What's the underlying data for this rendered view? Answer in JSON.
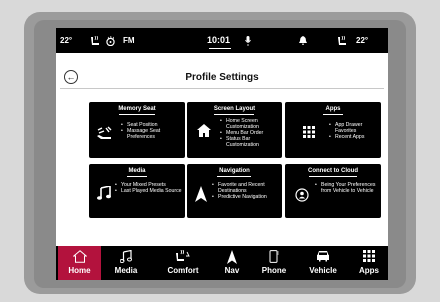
{
  "status_bar": {
    "temp_left": "22°",
    "seat_icon": "heated-seat-icon",
    "steering_icon": "heated-steering-icon",
    "radio_band": "FM",
    "clock": "10:01",
    "mic_icon": "microphone-icon",
    "notification_icon": "bell-icon",
    "temp_right": "22°"
  },
  "header": {
    "back_glyph": "←",
    "title": "Profile Settings"
  },
  "tiles": [
    {
      "title": "Memory Seat",
      "icon": "seat-memory-icon",
      "glyph": "⚙",
      "items": [
        "Seat Position",
        "Massage Seat Preferences"
      ]
    },
    {
      "title": "Screen Layout",
      "icon": "home-icon",
      "glyph": "⌂",
      "items": [
        "Home Screen Customization",
        "Menu Bar Order",
        "Status Bar Customization"
      ]
    },
    {
      "title": "Apps",
      "icon": "apps-grid-icon",
      "glyph": "▦",
      "items": [
        "App Drawer Favorites",
        "Recent Apps"
      ]
    },
    {
      "title": "Media",
      "icon": "music-note-icon",
      "glyph": "♫",
      "items": [
        "Your Mixed Presets",
        "Last Played Media Source"
      ]
    },
    {
      "title": "Navigation",
      "icon": "navigation-arrow-icon",
      "glyph": "▲",
      "items": [
        "Favorite and Recent Destinations",
        "Predictive Navigation"
      ]
    },
    {
      "title": "Connect to Cloud",
      "icon": "cloud-profile-icon",
      "glyph": "◉",
      "items": [
        "Being Your Preferences from Vehicle to Vehicle"
      ]
    }
  ],
  "nav": [
    {
      "label": "Home",
      "icon": "home-icon",
      "glyph": "⌂",
      "active": true
    },
    {
      "label": "Media",
      "icon": "music-note-icon",
      "glyph": "♫"
    },
    {
      "label": "Comfort",
      "icon": "comfort-icon",
      "glyph": "♨"
    },
    {
      "label": "Nav",
      "icon": "navigation-arrow-icon",
      "glyph": "▲"
    },
    {
      "label": "Phone",
      "icon": "phone-icon",
      "glyph": "▯"
    },
    {
      "label": "Vehicle",
      "icon": "car-icon",
      "glyph": "▬"
    },
    {
      "label": "Apps",
      "icon": "apps-grid-icon",
      "glyph": "▦"
    }
  ],
  "colors": {
    "active_nav": "#b3123d",
    "tile_bg": "#000000"
  }
}
